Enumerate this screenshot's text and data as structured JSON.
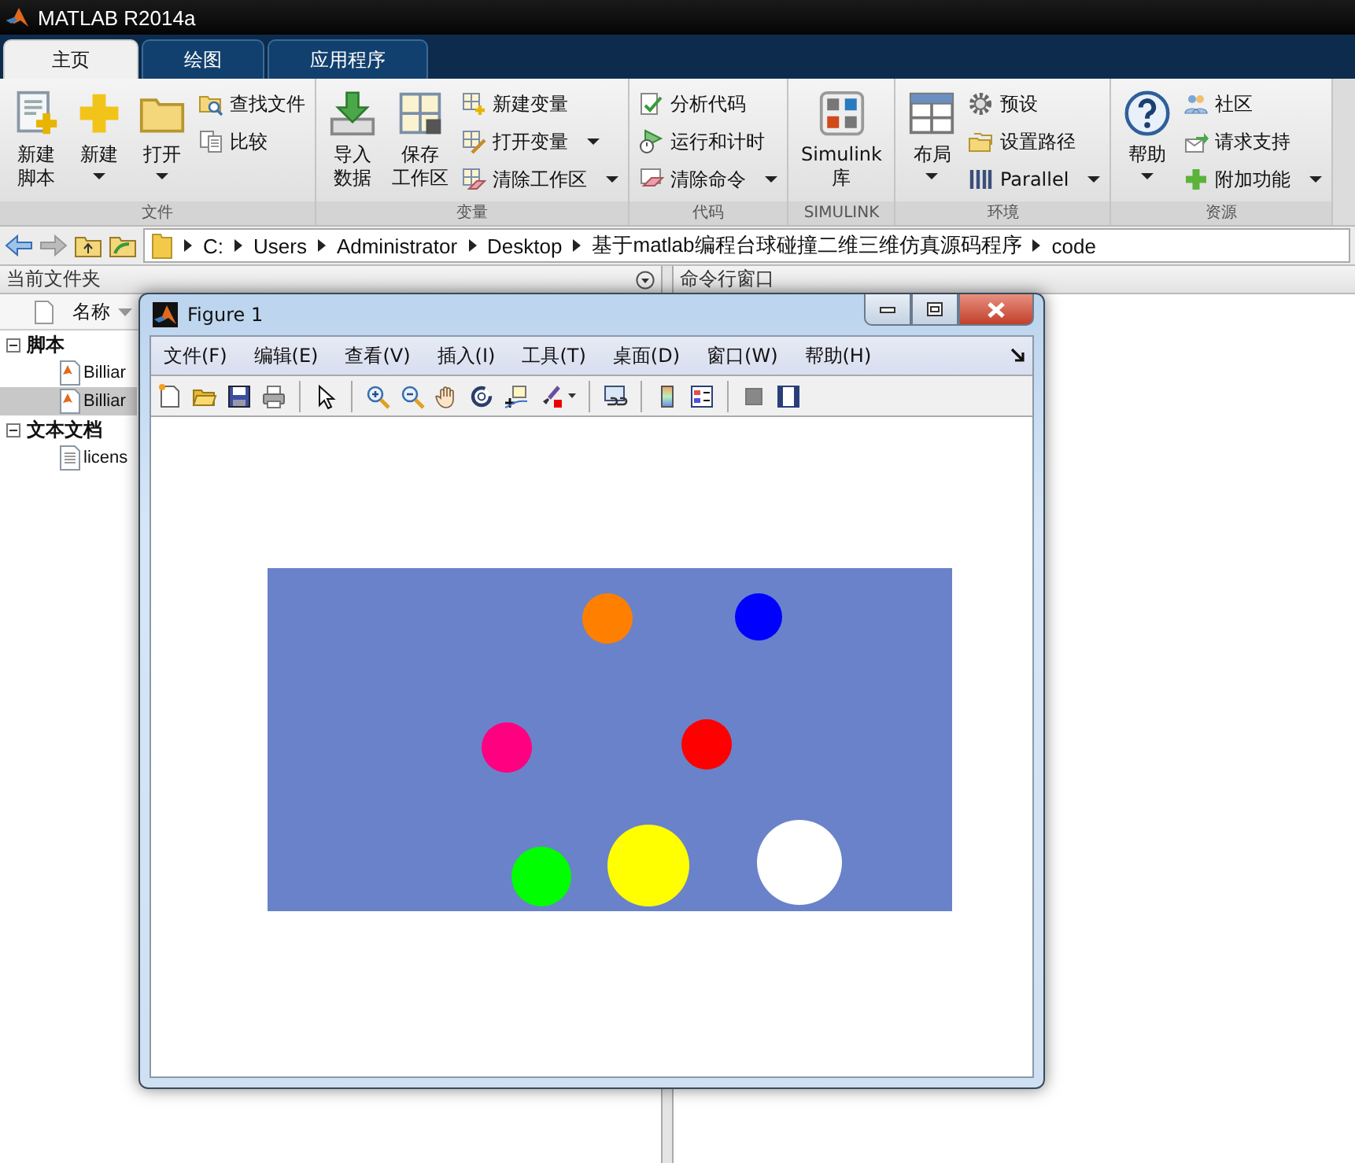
{
  "app": {
    "title": "MATLAB R2014a"
  },
  "ribbon_tabs": [
    {
      "label": "主页",
      "selected": true
    },
    {
      "label": "绘图",
      "selected": false
    },
    {
      "label": "应用程序",
      "selected": false
    }
  ],
  "ribbon_groups": [
    {
      "title": "文件",
      "items": [
        {
          "kind": "large",
          "lines": [
            "新建",
            "脚本"
          ],
          "dropdown": false
        },
        {
          "kind": "large",
          "lines": [
            "新建"
          ],
          "dropdown": true
        },
        {
          "kind": "large",
          "lines": [
            "打开"
          ],
          "dropdown": true
        },
        {
          "kind": "small",
          "label": "查找文件",
          "dropdown": false
        },
        {
          "kind": "small",
          "label": "比较",
          "dropdown": false
        }
      ]
    },
    {
      "title": "变量",
      "items": [
        {
          "kind": "large",
          "lines": [
            "导入",
            "数据"
          ],
          "dropdown": false
        },
        {
          "kind": "large",
          "lines": [
            "保存",
            "工作区"
          ],
          "dropdown": false
        },
        {
          "kind": "small",
          "label": "新建变量",
          "dropdown": false
        },
        {
          "kind": "small",
          "label": "打开变量",
          "dropdown": true
        },
        {
          "kind": "small",
          "label": "清除工作区",
          "dropdown": true
        }
      ]
    },
    {
      "title": "代码",
      "items": [
        {
          "kind": "small",
          "label": "分析代码",
          "dropdown": false
        },
        {
          "kind": "small",
          "label": "运行和计时",
          "dropdown": false
        },
        {
          "kind": "small",
          "label": "清除命令",
          "dropdown": true
        }
      ]
    },
    {
      "title": "SIMULINK",
      "items": [
        {
          "kind": "large",
          "lines": [
            "Simulink",
            "库"
          ],
          "dropdown": false
        }
      ]
    },
    {
      "title": "环境",
      "items": [
        {
          "kind": "large",
          "lines": [
            "布局"
          ],
          "dropdown": true
        },
        {
          "kind": "small",
          "label": "预设",
          "dropdown": false
        },
        {
          "kind": "small",
          "label": "设置路径",
          "dropdown": false
        },
        {
          "kind": "small",
          "label": "Parallel",
          "dropdown": true
        }
      ]
    },
    {
      "title": "资源",
      "items": [
        {
          "kind": "large",
          "lines": [
            "帮助"
          ],
          "dropdown": true
        },
        {
          "kind": "small",
          "label": "社区",
          "dropdown": false
        },
        {
          "kind": "small",
          "label": "请求支持",
          "dropdown": false
        },
        {
          "kind": "small",
          "label": "附加功能",
          "dropdown": true
        }
      ]
    }
  ],
  "address_bar": {
    "path": [
      "C:",
      "Users",
      "Administrator",
      "Desktop",
      "基于matlab编程台球碰撞二维三维仿真源码程序",
      "code"
    ]
  },
  "current_folder": {
    "title": "当前文件夹",
    "column": "名称",
    "tree": [
      {
        "label": "脚本",
        "expanded": true,
        "children": [
          {
            "label": "Billiar",
            "selected": false
          },
          {
            "label": "Billiar",
            "selected": true
          }
        ]
      },
      {
        "label": "文本文档",
        "expanded": true,
        "children": [
          {
            "label": "licens",
            "selected": false
          }
        ]
      }
    ]
  },
  "command_window": {
    "title": "命令行窗口"
  },
  "figure": {
    "title": "Figure 1",
    "menu": [
      "文件(F)",
      "编辑(E)",
      "查看(V)",
      "插入(I)",
      "工具(T)",
      "桌面(D)",
      "窗口(W)",
      "帮助(H)"
    ]
  }
}
